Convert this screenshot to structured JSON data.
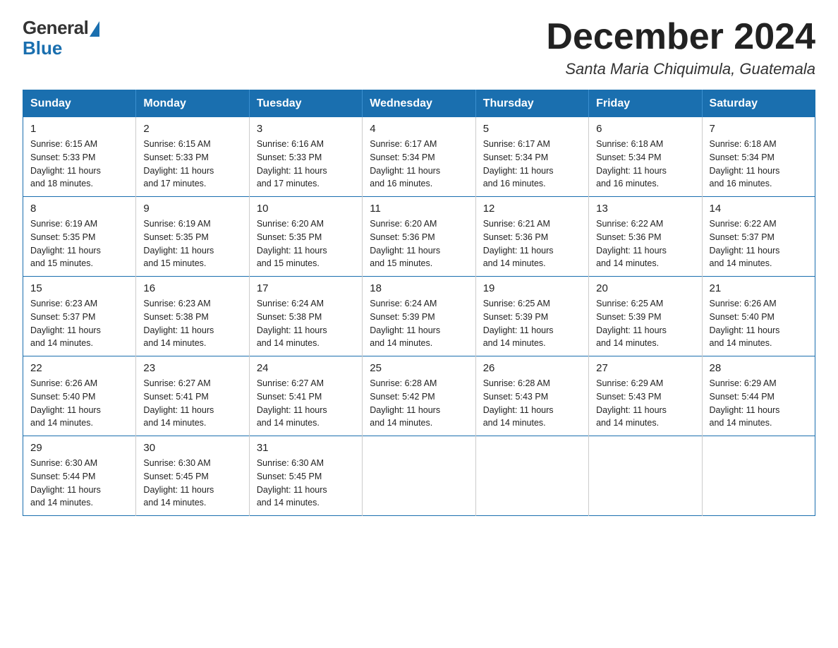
{
  "logo": {
    "general": "General",
    "blue": "Blue"
  },
  "header": {
    "month_year": "December 2024",
    "location": "Santa Maria Chiquimula, Guatemala"
  },
  "weekdays": [
    "Sunday",
    "Monday",
    "Tuesday",
    "Wednesday",
    "Thursday",
    "Friday",
    "Saturday"
  ],
  "weeks": [
    [
      {
        "day": "1",
        "sunrise": "6:15 AM",
        "sunset": "5:33 PM",
        "daylight": "11 hours and 18 minutes."
      },
      {
        "day": "2",
        "sunrise": "6:15 AM",
        "sunset": "5:33 PM",
        "daylight": "11 hours and 17 minutes."
      },
      {
        "day": "3",
        "sunrise": "6:16 AM",
        "sunset": "5:33 PM",
        "daylight": "11 hours and 17 minutes."
      },
      {
        "day": "4",
        "sunrise": "6:17 AM",
        "sunset": "5:34 PM",
        "daylight": "11 hours and 16 minutes."
      },
      {
        "day": "5",
        "sunrise": "6:17 AM",
        "sunset": "5:34 PM",
        "daylight": "11 hours and 16 minutes."
      },
      {
        "day": "6",
        "sunrise": "6:18 AM",
        "sunset": "5:34 PM",
        "daylight": "11 hours and 16 minutes."
      },
      {
        "day": "7",
        "sunrise": "6:18 AM",
        "sunset": "5:34 PM",
        "daylight": "11 hours and 16 minutes."
      }
    ],
    [
      {
        "day": "8",
        "sunrise": "6:19 AM",
        "sunset": "5:35 PM",
        "daylight": "11 hours and 15 minutes."
      },
      {
        "day": "9",
        "sunrise": "6:19 AM",
        "sunset": "5:35 PM",
        "daylight": "11 hours and 15 minutes."
      },
      {
        "day": "10",
        "sunrise": "6:20 AM",
        "sunset": "5:35 PM",
        "daylight": "11 hours and 15 minutes."
      },
      {
        "day": "11",
        "sunrise": "6:20 AM",
        "sunset": "5:36 PM",
        "daylight": "11 hours and 15 minutes."
      },
      {
        "day": "12",
        "sunrise": "6:21 AM",
        "sunset": "5:36 PM",
        "daylight": "11 hours and 14 minutes."
      },
      {
        "day": "13",
        "sunrise": "6:22 AM",
        "sunset": "5:36 PM",
        "daylight": "11 hours and 14 minutes."
      },
      {
        "day": "14",
        "sunrise": "6:22 AM",
        "sunset": "5:37 PM",
        "daylight": "11 hours and 14 minutes."
      }
    ],
    [
      {
        "day": "15",
        "sunrise": "6:23 AM",
        "sunset": "5:37 PM",
        "daylight": "11 hours and 14 minutes."
      },
      {
        "day": "16",
        "sunrise": "6:23 AM",
        "sunset": "5:38 PM",
        "daylight": "11 hours and 14 minutes."
      },
      {
        "day": "17",
        "sunrise": "6:24 AM",
        "sunset": "5:38 PM",
        "daylight": "11 hours and 14 minutes."
      },
      {
        "day": "18",
        "sunrise": "6:24 AM",
        "sunset": "5:39 PM",
        "daylight": "11 hours and 14 minutes."
      },
      {
        "day": "19",
        "sunrise": "6:25 AM",
        "sunset": "5:39 PM",
        "daylight": "11 hours and 14 minutes."
      },
      {
        "day": "20",
        "sunrise": "6:25 AM",
        "sunset": "5:39 PM",
        "daylight": "11 hours and 14 minutes."
      },
      {
        "day": "21",
        "sunrise": "6:26 AM",
        "sunset": "5:40 PM",
        "daylight": "11 hours and 14 minutes."
      }
    ],
    [
      {
        "day": "22",
        "sunrise": "6:26 AM",
        "sunset": "5:40 PM",
        "daylight": "11 hours and 14 minutes."
      },
      {
        "day": "23",
        "sunrise": "6:27 AM",
        "sunset": "5:41 PM",
        "daylight": "11 hours and 14 minutes."
      },
      {
        "day": "24",
        "sunrise": "6:27 AM",
        "sunset": "5:41 PM",
        "daylight": "11 hours and 14 minutes."
      },
      {
        "day": "25",
        "sunrise": "6:28 AM",
        "sunset": "5:42 PM",
        "daylight": "11 hours and 14 minutes."
      },
      {
        "day": "26",
        "sunrise": "6:28 AM",
        "sunset": "5:43 PM",
        "daylight": "11 hours and 14 minutes."
      },
      {
        "day": "27",
        "sunrise": "6:29 AM",
        "sunset": "5:43 PM",
        "daylight": "11 hours and 14 minutes."
      },
      {
        "day": "28",
        "sunrise": "6:29 AM",
        "sunset": "5:44 PM",
        "daylight": "11 hours and 14 minutes."
      }
    ],
    [
      {
        "day": "29",
        "sunrise": "6:30 AM",
        "sunset": "5:44 PM",
        "daylight": "11 hours and 14 minutes."
      },
      {
        "day": "30",
        "sunrise": "6:30 AM",
        "sunset": "5:45 PM",
        "daylight": "11 hours and 14 minutes."
      },
      {
        "day": "31",
        "sunrise": "6:30 AM",
        "sunset": "5:45 PM",
        "daylight": "11 hours and 14 minutes."
      },
      null,
      null,
      null,
      null
    ]
  ],
  "labels": {
    "sunrise": "Sunrise:",
    "sunset": "Sunset:",
    "daylight": "Daylight:"
  }
}
